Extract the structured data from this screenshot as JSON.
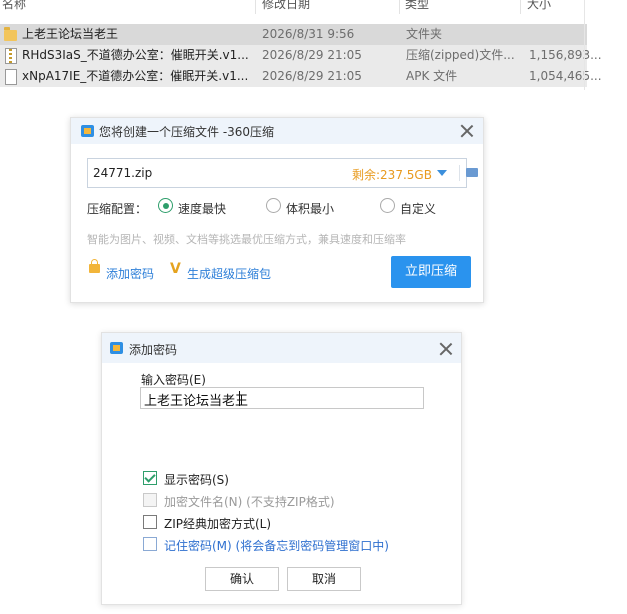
{
  "file_list": {
    "columns": {
      "name": "名称",
      "date": "修改日期",
      "type": "类型",
      "size": "大小"
    },
    "rows": [
      {
        "icon": "folder-icon",
        "name": "上老王论坛当老王",
        "date": "2026/8/31 9:56",
        "type": "文件夹",
        "size": ""
      },
      {
        "icon": "zip-icon",
        "name": "RHdS3IaS_不道德办公室：催眠开关.v1...",
        "date": "2026/8/29 21:05",
        "type": "压缩(zipped)文件...",
        "size": "1,156,893..."
      },
      {
        "icon": "apk-icon",
        "name": "xNpA17IE_不道德办公室：催眠开关.v1...",
        "date": "2026/8/29 21:05",
        "type": "APK 文件",
        "size": "1,054,465..."
      }
    ]
  },
  "compress_dialog": {
    "title": "您将创建一个压缩文件 -360压缩",
    "filename": "24771.zip",
    "free_space": "剩余:237.5GB",
    "config_label": "压缩配置：",
    "options": [
      "速度最快",
      "体积最小",
      "自定义"
    ],
    "selected_option": "速度最快",
    "hint": "智能为图片、视频、文档等挑选最优压缩方式，兼具速度和压缩率",
    "add_password_link": "添加密码",
    "super_zip_link": "生成超级压缩包",
    "compress_button": "立即压缩",
    "accent_color": "#2a93ee"
  },
  "password_dialog": {
    "title": "添加密码",
    "input_label": "输入密码(E)",
    "password_value": "上老王论坛当老王",
    "checkboxes": [
      {
        "label": "显示密码(S)",
        "checked": true,
        "enabled": true
      },
      {
        "label": "加密文件名(N)  (不支持ZIP格式)",
        "checked": false,
        "enabled": false
      },
      {
        "label": "ZIP经典加密方式(L)",
        "checked": false,
        "enabled": true
      },
      {
        "label": "记住密码(M)  (将会备忘到密码管理窗口中)",
        "checked": false,
        "enabled": true
      }
    ],
    "ok_button": "确认",
    "cancel_button": "取消"
  }
}
